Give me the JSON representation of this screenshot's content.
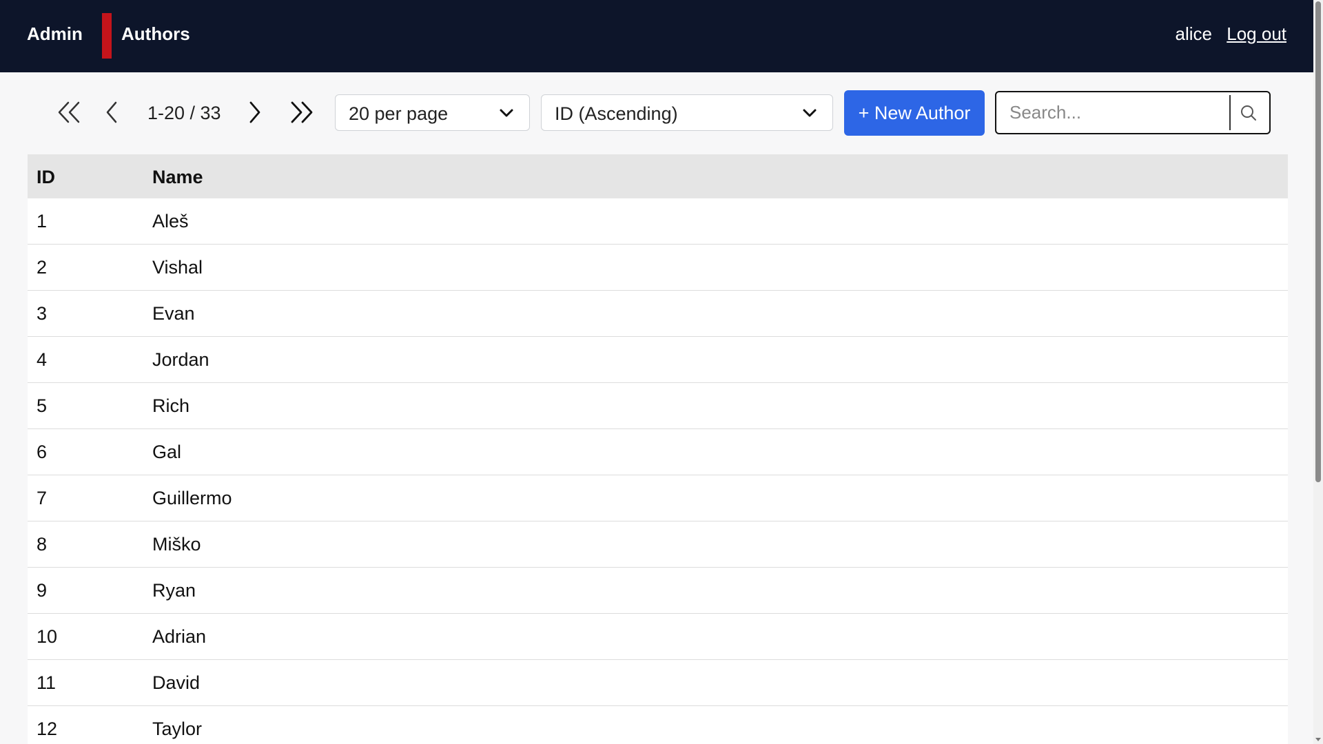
{
  "header": {
    "brand": "Admin",
    "section_title": "Authors",
    "user": "alice",
    "logout_label": "Log out",
    "colors": {
      "background": "#0d152a",
      "divider_accent": "#c4141b"
    }
  },
  "toolbar": {
    "pagination": {
      "first_icon": "double-chevron-left-icon",
      "prev_icon": "chevron-left-icon",
      "range_text": "1-20 / 33",
      "next_icon": "chevron-right-icon",
      "last_icon": "double-chevron-right-icon"
    },
    "per_page_select": {
      "selected": "20 per page"
    },
    "sort_select": {
      "selected": "ID (Ascending)"
    },
    "new_button_label": "+ New Author",
    "new_button_color": "#2d66e6",
    "search": {
      "placeholder": "Search...",
      "value": "",
      "icon": "search-icon"
    }
  },
  "table": {
    "columns": [
      "ID",
      "Name"
    ],
    "rows": [
      {
        "id": "1",
        "name": "Aleš"
      },
      {
        "id": "2",
        "name": "Vishal"
      },
      {
        "id": "3",
        "name": "Evan"
      },
      {
        "id": "4",
        "name": "Jordan"
      },
      {
        "id": "5",
        "name": "Rich"
      },
      {
        "id": "6",
        "name": "Gal"
      },
      {
        "id": "7",
        "name": "Guillermo"
      },
      {
        "id": "8",
        "name": "Miško"
      },
      {
        "id": "9",
        "name": "Ryan"
      },
      {
        "id": "10",
        "name": "Adrian"
      },
      {
        "id": "11",
        "name": "David"
      },
      {
        "id": "12",
        "name": "Taylor"
      }
    ]
  }
}
